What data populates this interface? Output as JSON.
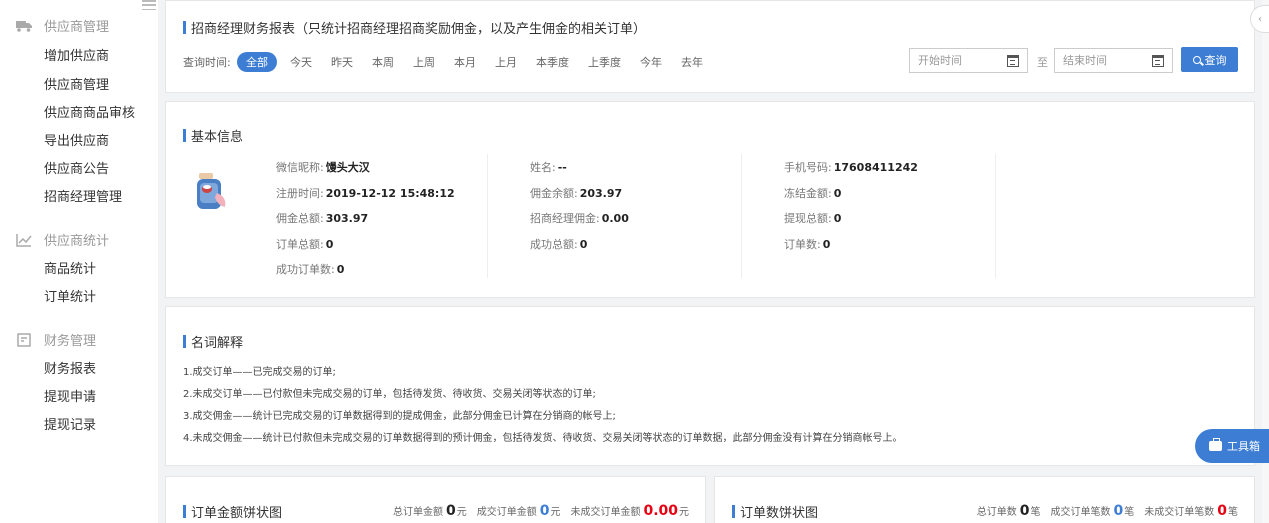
{
  "sidebar": {
    "groups": [
      {
        "title": "供应商管理",
        "icon": "truck-icon",
        "items": [
          "增加供应商",
          "供应商管理",
          "供应商商品审核",
          "导出供应商",
          "供应商公告",
          "招商经理管理"
        ]
      },
      {
        "title": "供应商统计",
        "icon": "line-chart-icon",
        "items": [
          "商品统计",
          "订单统计"
        ]
      },
      {
        "title": "财务管理",
        "icon": "finance-icon",
        "items": [
          "财务报表",
          "提现申请",
          "提现记录"
        ]
      }
    ]
  },
  "report": {
    "title": "招商经理财务报表（只统计招商经理招商奖励佣金，以及产生佣金的相关订单）",
    "query_label": "查询时间:",
    "filters": [
      "全部",
      "今天",
      "昨天",
      "本周",
      "上周",
      "本月",
      "上月",
      "本季度",
      "上季度",
      "今年",
      "去年"
    ],
    "active_filter": "全部",
    "start_placeholder": "开始时间",
    "end_placeholder": "结束时间",
    "to_label": "至",
    "search_label": "查询"
  },
  "basic": {
    "title": "基本信息",
    "col1": [
      {
        "label": "微信昵称:",
        "value": "馒头大汉"
      },
      {
        "label": "注册时间:",
        "value": "2019-12-12 15:48:12"
      },
      {
        "label": "佣金总额:",
        "value": "303.97"
      },
      {
        "label": "订单总额:",
        "value": "0"
      },
      {
        "label": "成功订单数:",
        "value": "0"
      }
    ],
    "col2": [
      {
        "label": "姓名:",
        "value": "--"
      },
      {
        "label": "佣金余额:",
        "value": "203.97"
      },
      {
        "label": "招商经理佣金:",
        "value": "0.00"
      },
      {
        "label": "成功总额:",
        "value": "0"
      }
    ],
    "col3": [
      {
        "label": "手机号码:",
        "value": "17608411242"
      },
      {
        "label": "冻结金额:",
        "value": "0"
      },
      {
        "label": "提现总额:",
        "value": "0"
      },
      {
        "label": "订单数:",
        "value": "0"
      }
    ]
  },
  "glossary": {
    "title": "名词解释",
    "lines": [
      "1.成交订单——已完成交易的订单;",
      "2.未成交订单——已付款但未完成交易的订单，包括待发货、待收货、交易关闭等状态的订单;",
      "3.成交佣金——统计已完成交易的订单数据得到的提成佣金，此部分佣金已计算在分销商的帐号上;",
      "4.未成交佣金——统计已付款但未完成交易的订单数据得到的预计佣金，包括待发货、待收货、交易关闭等状态的订单数据，此部分佣金没有计算在分销商帐号上。"
    ]
  },
  "amount_chart": {
    "title": "订单金额饼状图",
    "total_label": "总订单金额",
    "total_value": "0",
    "total_unit": "元",
    "done_label": "成交订单金额",
    "done_value": "0",
    "done_unit": "元",
    "undone_label": "未成交订单金额",
    "undone_value": "0.00",
    "undone_unit": "元"
  },
  "count_chart": {
    "title": "订单数饼状图",
    "total_label": "总订单数",
    "total_value": "0",
    "total_unit": "笔",
    "done_label": "成交订单笔数",
    "done_value": "0",
    "done_unit": "笔",
    "undone_label": "未成交订单笔数",
    "undone_value": "0",
    "undone_unit": "笔"
  },
  "toolbox_label": "工具箱",
  "colors": {
    "accent": "#3d7ed4",
    "red": "#e60012"
  }
}
